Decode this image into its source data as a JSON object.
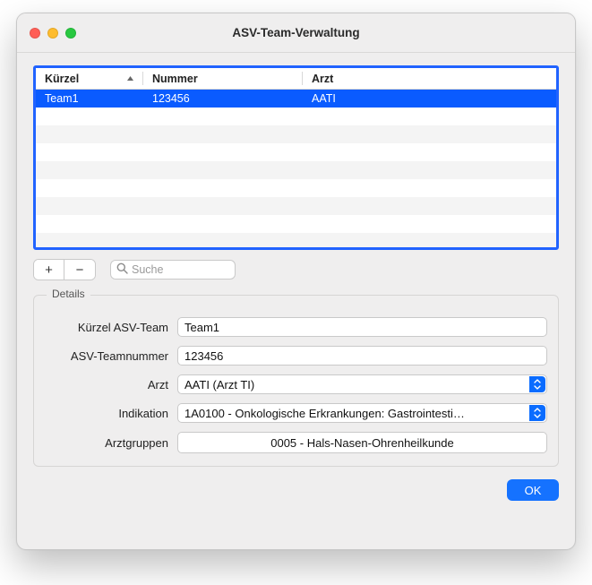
{
  "window": {
    "title": "ASV-Team-Verwaltung"
  },
  "table": {
    "columns": {
      "kurzel": "Kürzel",
      "nummer": "Nummer",
      "arzt": "Arzt"
    },
    "sort_column": "kurzel",
    "sort_asc": true,
    "rows": [
      {
        "kurzel": "Team1",
        "nummer": "123456",
        "arzt": "AATI",
        "selected": true
      }
    ]
  },
  "toolbar": {
    "add_label": "+",
    "remove_label": "−",
    "search_placeholder": "Suche",
    "search_value": ""
  },
  "details": {
    "legend": "Details",
    "labels": {
      "kurzel": "Kürzel ASV-Team",
      "teamnummer": "ASV-Teamnummer",
      "arzt": "Arzt",
      "indikation": "Indikation",
      "arztgruppen": "Arztgruppen"
    },
    "values": {
      "kurzel": "Team1",
      "teamnummer": "123456",
      "arzt": "AATI (Arzt TI)",
      "indikation": "1A0100 - Onkologische Erkrankungen: Gastrointesti…",
      "arztgruppen": "0005 - Hals-Nasen-Ohrenheilkunde"
    }
  },
  "footer": {
    "ok": "OK"
  },
  "colors": {
    "accent": "#0a5bff",
    "button": "#1572ff"
  }
}
